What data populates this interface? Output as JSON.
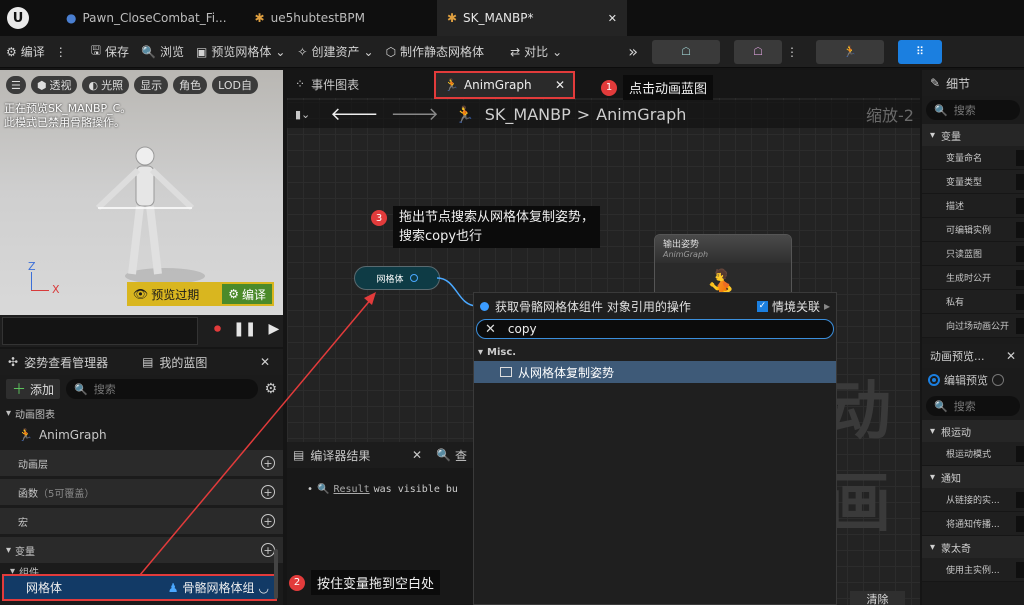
{
  "titlebar": {
    "tabs": [
      {
        "label": "Pawn_CloseCombat_Fi..."
      },
      {
        "label": "ue5hubtestBPM"
      },
      {
        "label": "SK_MANBP*"
      }
    ]
  },
  "toolbar": {
    "compile": "编译",
    "save": "保存",
    "browse": "浏览",
    "preview_mesh": "预览网格体",
    "create_asset": "创建资产",
    "make_static_mesh": "制作静态网格体",
    "diff": "对比"
  },
  "viewport": {
    "chips": [
      "透视",
      "光照",
      "显示",
      "角色",
      "LOD自"
    ],
    "preview_msg_line1": "正在预览SK_MANBP_C。",
    "preview_msg_line2": "此模式已禁用骨骼操作。",
    "preview_expired": "预览过期",
    "compile_btn": "编译",
    "axis_z": "Z",
    "axis_x": "X"
  },
  "left_panel": {
    "tab_pose": "姿势查看管理器",
    "tab_mybp": "我的蓝图",
    "add_label": "添加",
    "search_placeholder": "搜索",
    "section_animgraphs": "动画图表",
    "animgraph_item": "AnimGraph",
    "anim_layers": "动画层",
    "functions": "函数",
    "functions_note": "（5可覆盖）",
    "macros": "宏",
    "variables": "变量",
    "components": "组件",
    "mesh_var_name": "网格体",
    "mesh_var_type": "骨骼网格体组"
  },
  "graph": {
    "tab_event": "事件图表",
    "tab_anim": "AnimGraph",
    "crumb_bp": "SK_MANBP",
    "crumb_sep": ">",
    "crumb_graph": "AnimGraph",
    "zoom": "缩放-2",
    "node_mesh": "网格体",
    "output_pose": "输出姿势",
    "output_sub": "AnimGraph",
    "watermark": "动画",
    "menu": {
      "title": "获取骨骼网格体组件 对象引用的操作",
      "context_label": "情境关联",
      "search_value": "copy",
      "category": "Misc.",
      "item": "从网格体复制姿势"
    },
    "compiler_tab": "编译器结果",
    "search_tab": "查",
    "compiler_msg_link": "Result",
    "compiler_msg_rest": "was visible bu",
    "clear_btn": "清除"
  },
  "callouts": {
    "c1_num": "1",
    "c1_text": "点击动画蓝图",
    "c2_num": "2",
    "c2_text": "按住变量拖到空白处",
    "c3_num": "3",
    "c3_line1": "拖出节点搜索从网格体复制姿势，",
    "c3_line2": "搜索copy也行"
  },
  "right_panel": {
    "details_tab": "细节",
    "search_placeholder": "搜索",
    "sec_variable": "变量",
    "props": [
      "变量命名",
      "变量类型",
      "描述",
      "可编辑实例",
      "只读蓝图",
      "生成时公开",
      "私有",
      "向过场动画公开"
    ],
    "anim_preview_tab": "动画预览...",
    "edit_preview": "编辑预览",
    "search2_placeholder": "搜索",
    "sec_root_motion": "根运动",
    "root_motion_mode": "根运动模式",
    "sec_notify": "通知",
    "notify_props": [
      "从链接的实...",
      "将通知传播..."
    ],
    "sec_montage": "蒙太奇",
    "montage_prop": "使用主实例..."
  },
  "colors": {
    "accent_blue": "#1b7fe0",
    "annotation_red": "#e23b3b",
    "compile_green": "#4a8a2a"
  }
}
